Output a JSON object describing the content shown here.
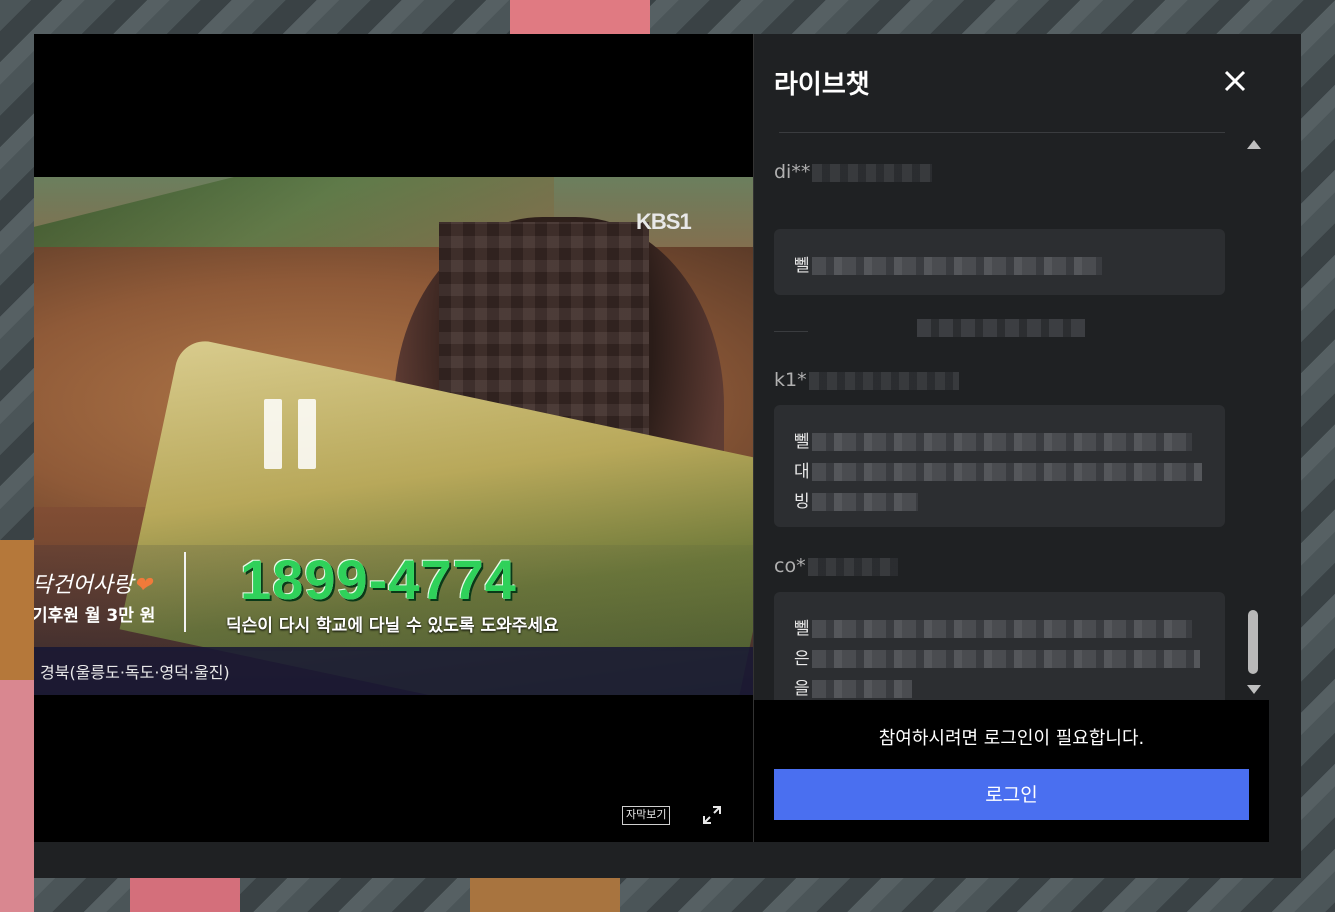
{
  "video": {
    "channel_logo": "KBS1",
    "caption_left_title": "닥건어사랑",
    "caption_left_sub": "기후원 월 3만 원",
    "caption_phone": "1899-4774",
    "caption_sub": "딕슨이 다시 학교에 다닐 수 있도록 도와주세요",
    "region": "경북(울릉도·독도·영덕·울진)",
    "subtitle_button": "자막보기"
  },
  "chat": {
    "title": "라이브챗",
    "messages": [
      {
        "user": "di**",
        "lines": [
          "뻴"
        ]
      },
      {
        "user": "k1*",
        "lines": [
          "뻴",
          "대",
          "빙"
        ]
      },
      {
        "user": "co*",
        "lines": [
          "뻴",
          "은",
          "을"
        ]
      }
    ],
    "login_notice": "참여하시려면 로그인이 필요합니다.",
    "login_button": "로그인"
  },
  "colors": {
    "accent": "#4a6ff0",
    "phone_green": "#2fd15a"
  }
}
